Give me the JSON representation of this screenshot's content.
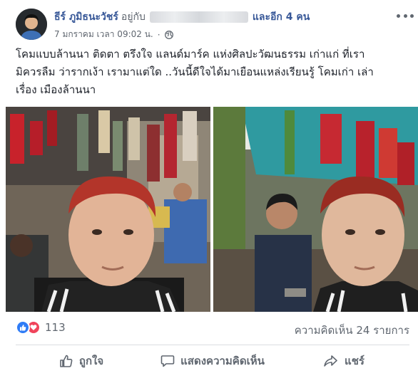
{
  "post": {
    "author": "ธีร์ ภูมิธนะวัชร์",
    "with_prefix": "อยู่กับ",
    "and_others": "และอีก 4 คน",
    "timestamp": "7 มกราคม เวลา 09:02 น.",
    "dot": "·",
    "privacy_icon": "globe-icon",
    "text_lines": [
      "โคมแบบล้านนา ติดตา ตรึงใจ แลนด์มาร์ค แห่งศิลปะวัฒนธรรม เก่าแก่ ที่เรา",
      "มิควรลืม ว่ารากเง้า เรามาแต่ใด ..วันนี้ดีใจได้มาเยือนแหล่งเรียนรู้ โคมเก่า เล่า",
      "เรื่อง เมืองล้านนา"
    ]
  },
  "stats": {
    "reaction_count": "113",
    "comments": "ความคิดเห็น 24 รายการ"
  },
  "actions": {
    "like": "ถูกใจ",
    "comment": "แสดงความคิดเห็น",
    "share": "แชร์"
  },
  "colors": {
    "link_blue": "#385898",
    "like_blue": "#2f7cf6",
    "love_red": "#f0445b",
    "muted": "#606770"
  }
}
